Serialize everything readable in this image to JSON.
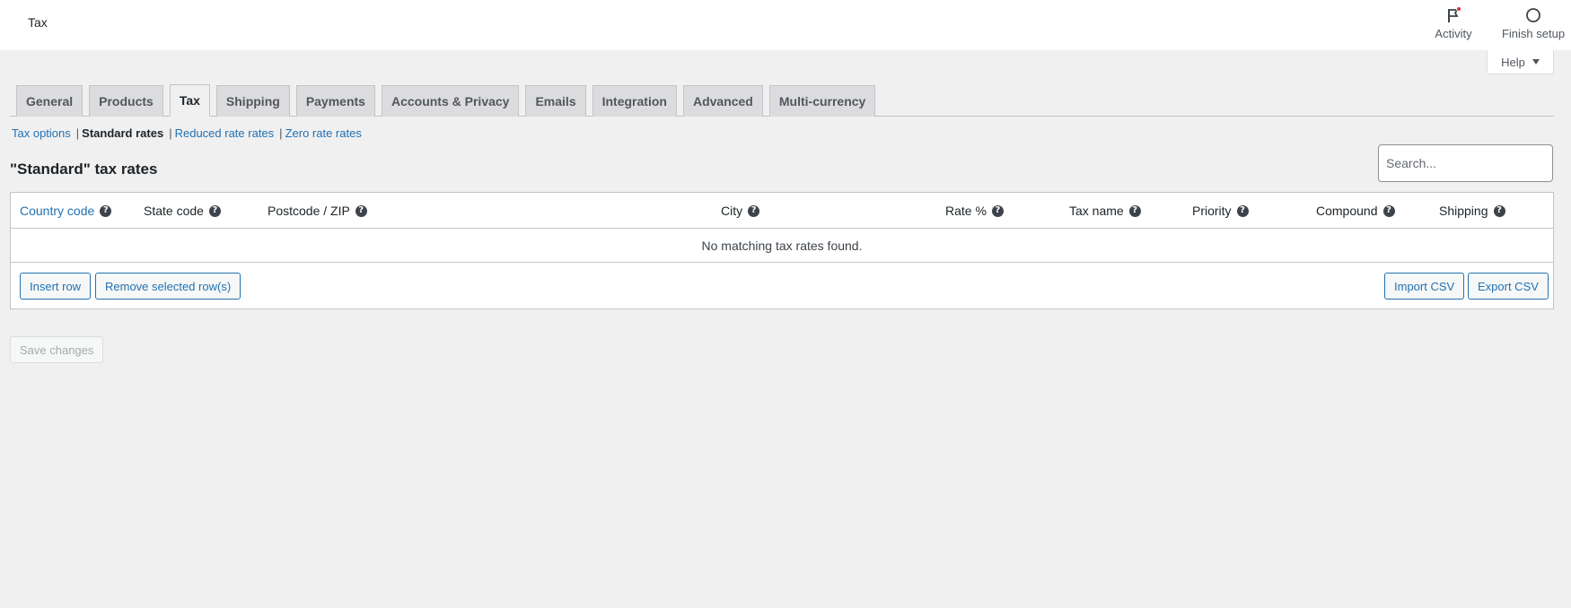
{
  "header": {
    "title": "Tax",
    "actions": [
      {
        "label": "Activity",
        "icon": "flag-icon",
        "has_notification": true
      },
      {
        "label": "Finish setup",
        "icon": "circle-progress-icon"
      }
    ],
    "help_label": "Help"
  },
  "tabs": [
    {
      "label": "General"
    },
    {
      "label": "Products"
    },
    {
      "label": "Tax",
      "active": true
    },
    {
      "label": "Shipping"
    },
    {
      "label": "Payments"
    },
    {
      "label": "Accounts & Privacy"
    },
    {
      "label": "Emails"
    },
    {
      "label": "Integration"
    },
    {
      "label": "Advanced"
    },
    {
      "label": "Multi-currency"
    }
  ],
  "subnav": {
    "items": [
      {
        "label": "Tax options"
      },
      {
        "label": "Standard rates",
        "current": true
      },
      {
        "label": "Reduced rate rates"
      },
      {
        "label": "Zero rate rates"
      }
    ],
    "separator": "|"
  },
  "section": {
    "title": "\"Standard\" tax rates",
    "search_placeholder": "Search..."
  },
  "table": {
    "columns": [
      {
        "label": "Country code"
      },
      {
        "label": "State code"
      },
      {
        "label": "Postcode / ZIP"
      },
      {
        "label": "City"
      },
      {
        "label": "Rate %"
      },
      {
        "label": "Tax name"
      },
      {
        "label": "Priority"
      },
      {
        "label": "Compound"
      },
      {
        "label": "Shipping"
      }
    ],
    "help_glyph": "?",
    "empty_message": "No matching tax rates found.",
    "buttons": {
      "insert_row": "Insert row",
      "remove_rows": "Remove selected row(s)",
      "import_csv": "Import CSV",
      "export_csv": "Export CSV"
    }
  },
  "footer": {
    "save_label": "Save changes"
  },
  "colors": {
    "link": "#2271b1",
    "notification": "#d63638",
    "background": "#f0f0f1"
  }
}
